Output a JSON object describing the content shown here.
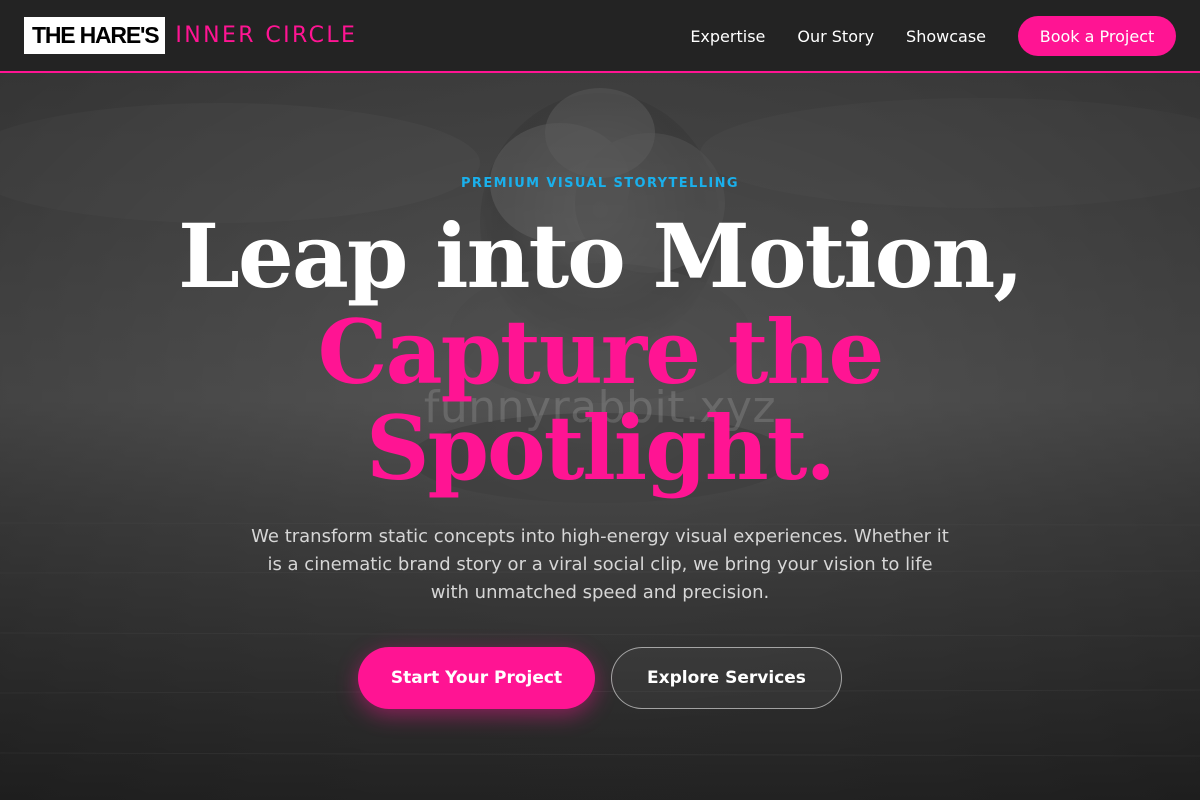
{
  "header": {
    "logo_main": "THE HARE'S",
    "logo_sub": "INNER CIRCLE",
    "nav": [
      {
        "label": "Expertise"
      },
      {
        "label": "Our Story"
      },
      {
        "label": "Showcase"
      }
    ],
    "cta_label": "Book a Project"
  },
  "hero": {
    "eyebrow": "PREMIUM VISUAL STORYTELLING",
    "headline_line1": "Leap into Motion,",
    "headline_line2": "Capture the",
    "headline_line3": "Spotlight.",
    "watermark": "funnyrabbit.xyz",
    "subtext": "We transform static concepts into high-energy visual experiences. Whether it is a cinematic brand story or a viral social clip, we bring your vision to life with unmatched speed and precision.",
    "primary_button": "Start Your Project",
    "secondary_button": "Explore Services"
  },
  "colors": {
    "accent": "#ff1493",
    "eyebrow": "#1ab0ec",
    "header_bg": "#232323"
  }
}
